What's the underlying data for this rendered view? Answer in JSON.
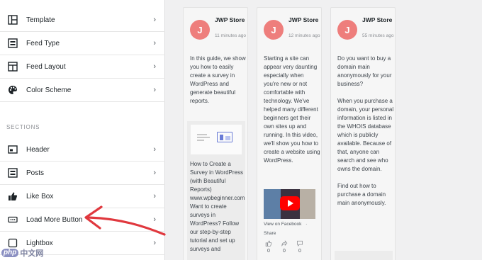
{
  "sidebar": {
    "items": [
      {
        "label": "Template",
        "icon": "template-icon"
      },
      {
        "label": "Feed Type",
        "icon": "feed-type-icon"
      },
      {
        "label": "Feed Layout",
        "icon": "feed-layout-icon"
      },
      {
        "label": "Color Scheme",
        "icon": "palette-icon"
      }
    ],
    "sections_label": "SECTIONS",
    "sections": [
      {
        "label": "Header",
        "icon": "header-icon"
      },
      {
        "label": "Posts",
        "icon": "posts-icon"
      },
      {
        "label": "Like Box",
        "icon": "thumbs-up-icon"
      },
      {
        "label": "Load More Button",
        "icon": "load-more-icon"
      },
      {
        "label": "Lightbox",
        "icon": "lightbox-icon"
      }
    ],
    "chevron": "›"
  },
  "posts": [
    {
      "avatar_letter": "J",
      "author": "JWP Store",
      "time": "11 minutes ago",
      "text": "In this guide, we show you how to easily create a survey in WordPress and generate beautiful reports.",
      "link_title": "How to Create a Survey in WordPress (with Beautiful Reports) www.wpbeginner.com Want to create surveys in WordPress? Follow our step-by-step tutorial and set up surveys and"
    },
    {
      "avatar_letter": "J",
      "author": "JWP Store",
      "time": "12 minutes ago",
      "text": "Starting a site can appear very daunting especially when you're new or not comfortable with technology. We've helped many different beginners get their own sites up and running. In this video, we'll show you how to create a website using WordPress.",
      "view_on": "View on Facebook",
      "dot": "·",
      "share": "Share",
      "reactions": [
        {
          "icon": "like-icon",
          "count": "0"
        },
        {
          "icon": "share-icon",
          "count": "0"
        },
        {
          "icon": "comment-icon",
          "count": "0"
        }
      ]
    },
    {
      "avatar_letter": "J",
      "author": "JWP Store",
      "time": "55 minutes ago",
      "text": "Do you want to buy a domain main anonymously for your business?\n\nWhen you purchase a domain, your personal information is listed in the WHOIS database which is publicly available. Because of that, anyone can search and see who owns the domain.\n\nFind out how to purchase a domain main anonymously."
    }
  ],
  "watermark": {
    "badge": "php",
    "text": "中文网"
  },
  "colors": {
    "avatar": "#ee7e7c",
    "arrow": "#e0383e",
    "play": "#ff0000"
  }
}
